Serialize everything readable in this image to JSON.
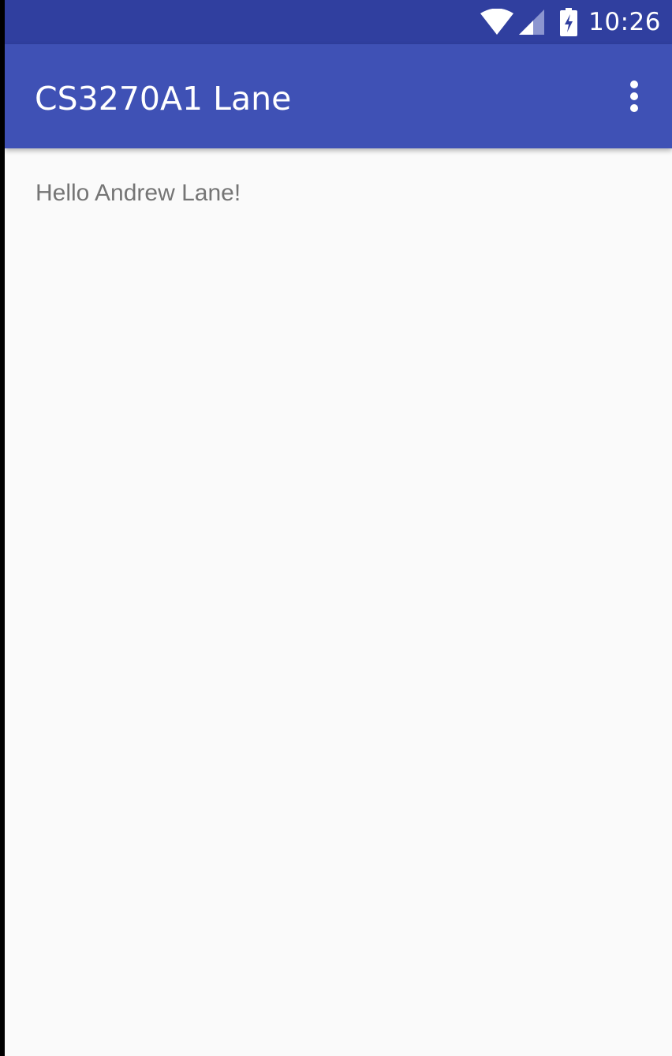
{
  "status_bar": {
    "time": "10:26",
    "icons": [
      "wifi-icon",
      "cell-signal-icon",
      "battery-charging-icon"
    ]
  },
  "app_bar": {
    "title": "CS3270A1 Lane",
    "overflow_icon": "more-vert-icon"
  },
  "content": {
    "greeting": "Hello Andrew Lane!"
  },
  "colors": {
    "status_bar": "#303f9f",
    "app_bar": "#3f51b5",
    "background": "#fafafa",
    "body_text": "#757575"
  }
}
